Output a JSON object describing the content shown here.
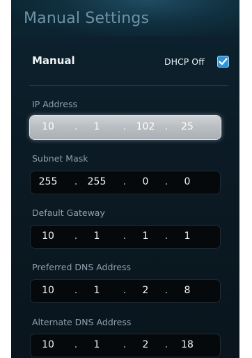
{
  "header": {
    "title": "Manual Settings"
  },
  "mode": {
    "label": "Manual",
    "dhcp_label": "DHCP Off",
    "dhcp_checked": true
  },
  "fields": [
    {
      "label": "IP Address",
      "octets": [
        "10",
        "1",
        "102",
        "25"
      ],
      "active": true
    },
    {
      "label": "Subnet Mask",
      "octets": [
        "255",
        "255",
        "0",
        "0"
      ],
      "active": false
    },
    {
      "label": "Default Gateway",
      "octets": [
        "10",
        "1",
        "1",
        "1"
      ],
      "active": false
    },
    {
      "label": "Preferred DNS Address",
      "octets": [
        "10",
        "1",
        "2",
        "8"
      ],
      "active": false
    },
    {
      "label": "Alternate DNS Address",
      "octets": [
        "10",
        "1",
        "2",
        "18"
      ],
      "active": false
    }
  ],
  "separator": ".",
  "colors": {
    "accent": "#2f95d6",
    "background": "#0b1a24",
    "title": "#6e92a6"
  }
}
